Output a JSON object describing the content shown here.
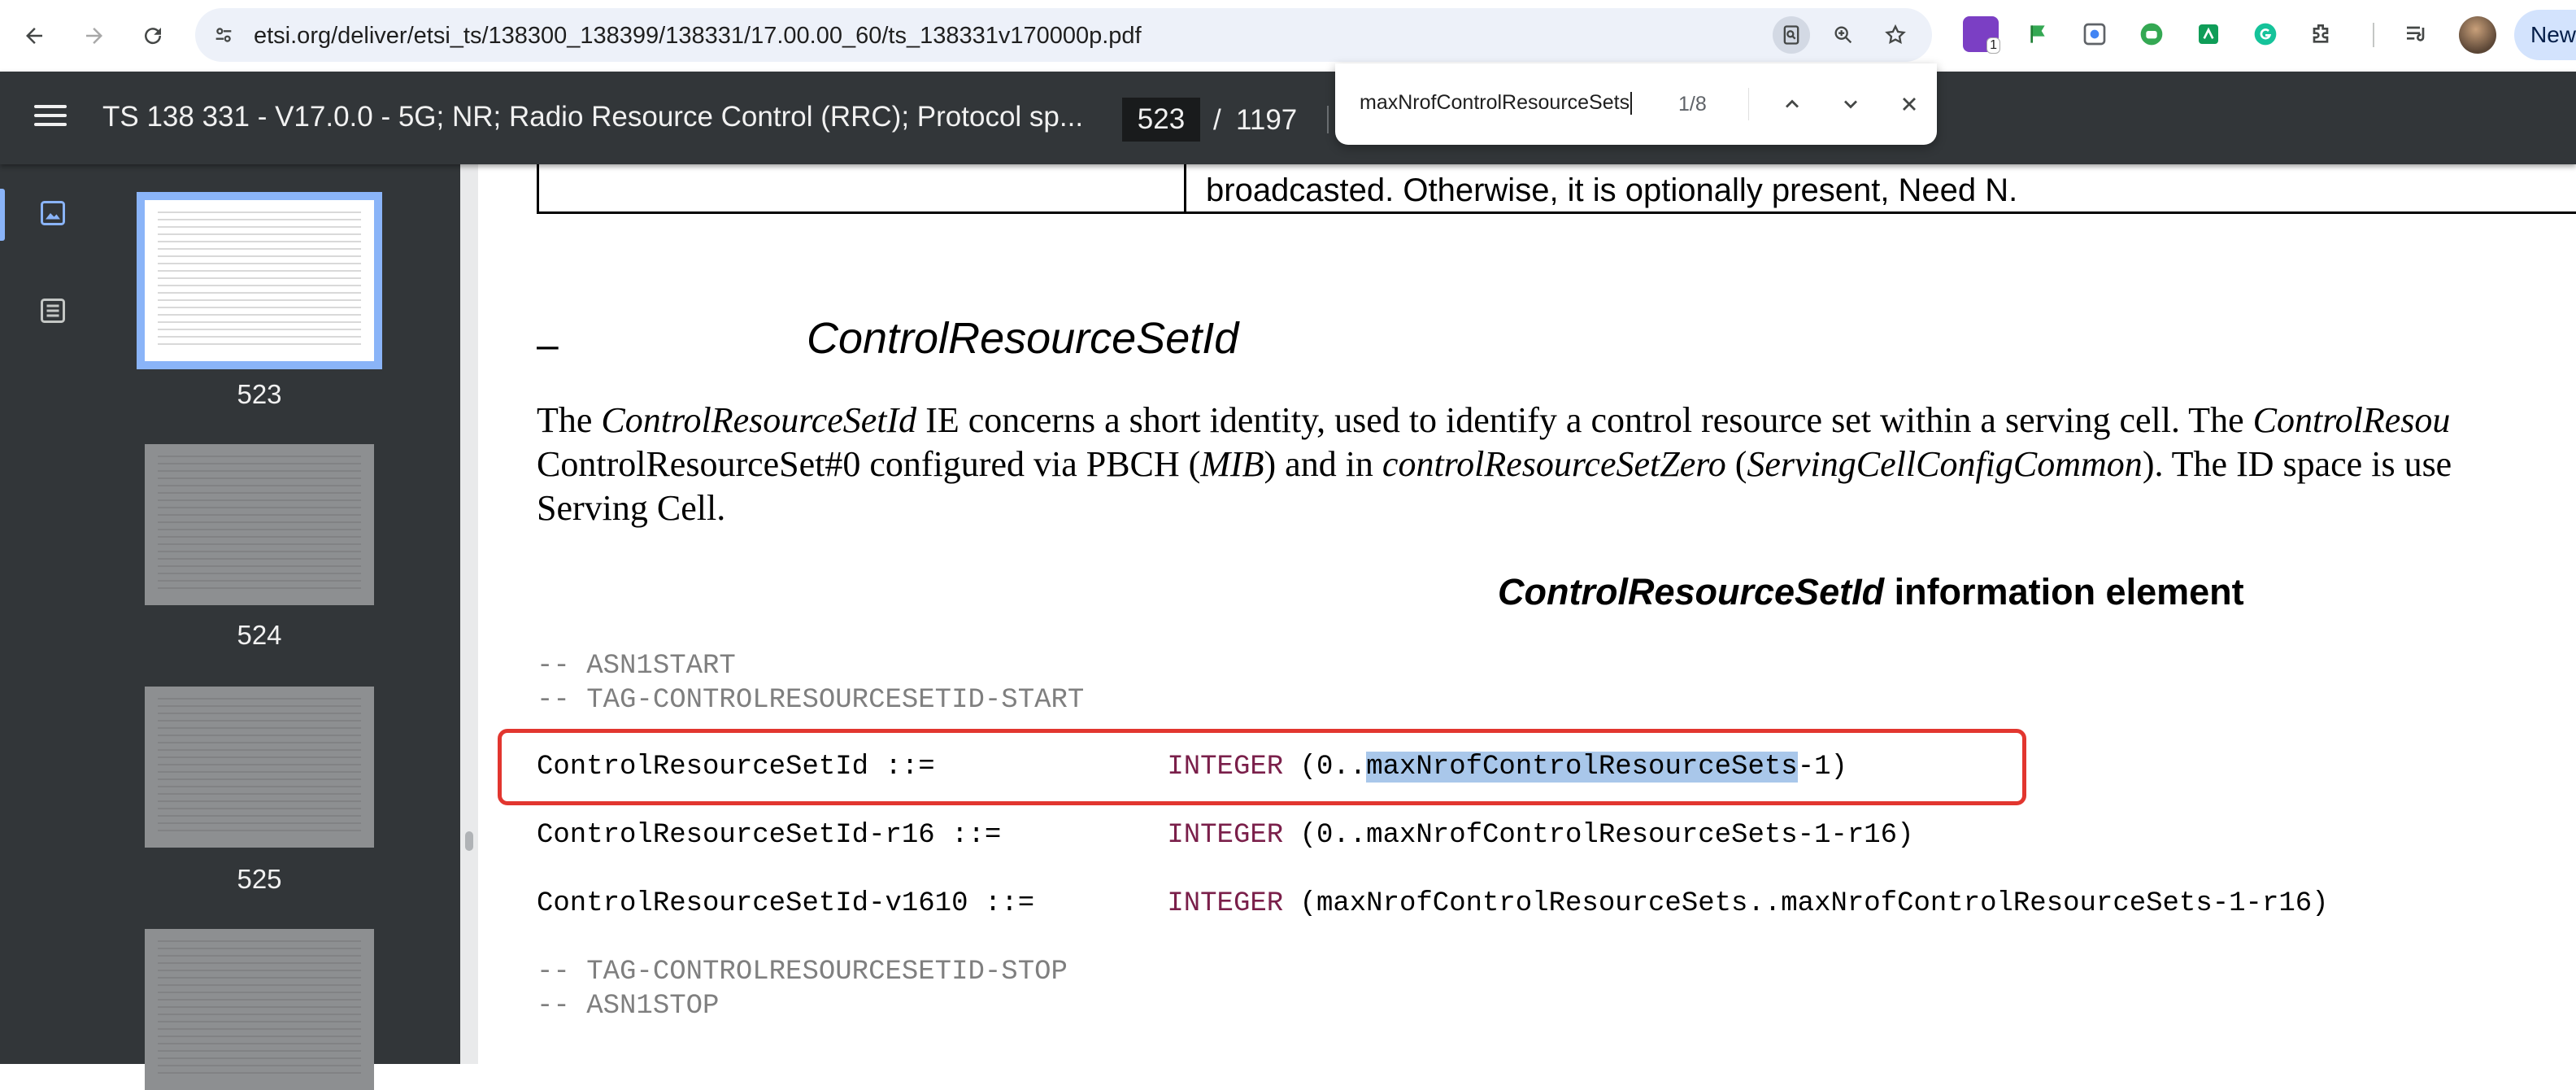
{
  "browser": {
    "url": "etsi.org/deliver/etsi_ts/138300_138399/138331/17.00.00_60/ts_138331v170000p.pdf",
    "extension_badge": "1",
    "new_button_label": "New",
    "icons": [
      "back-arrow-icon",
      "forward-arrow-icon",
      "reload-icon",
      "site-info-icon",
      "pdf-search-icon",
      "zoom-icon",
      "star-icon",
      "extensions-puzzle-icon",
      "media-control-icon"
    ]
  },
  "viewer": {
    "title": "TS 138 331 - V17.0.0 - 5G; NR; Radio Resource Control (RRC); Protocol sp...",
    "current_page": "523",
    "separator": "/",
    "total_pages": "1197"
  },
  "find": {
    "query": "maxNrofControlResourceSets",
    "count": "1/8"
  },
  "thumbnails": [
    {
      "page": "523",
      "selected": true
    },
    {
      "page": "524",
      "selected": false
    },
    {
      "page": "525",
      "selected": false
    },
    {
      "page": "",
      "selected": false
    }
  ],
  "document": {
    "table_fragment": "broadcasted. Otherwise, it is optionally present, Need N.",
    "clause_dash": "–",
    "clause_title": "ControlResourceSetId",
    "para": {
      "l1_a": "The ",
      "l1_b": "ControlResourceSetId",
      "l1_c": " IE concerns a short identity, used to identify a control resource set within a serving cell. The ",
      "l1_d": "ControlResou",
      "l2_a": "ControlResourceSet#0 configured via PBCH (",
      "l2_b": "MIB",
      "l2_c": ") and in ",
      "l2_d": "controlResourceSetZero",
      "l2_e": " (",
      "l2_f": "ServingCellConfigCommon",
      "l2_g": "). The ID space is use",
      "l3": "Serving Cell."
    },
    "ie_heading_italic": "ControlResourceSetId",
    "ie_heading_rest": " information element",
    "asn": {
      "c1": "-- ASN1START",
      "c2": "-- TAG-CONTROLRESOURCESETID-START",
      "l1_name": "ControlResourceSetId ::=              ",
      "l1_type": "INTEGER",
      "l1_pre": " (0..",
      "l1_hl": "maxNrofControlResourceSets",
      "l1_post": "-1)",
      "l2_name": "ControlResourceSetId-r16 ::=          ",
      "l2_type": "INTEGER",
      "l2_rest": " (0..maxNrofControlResourceSets-1-r16)",
      "l3_name": "ControlResourceSetId-v1610 ::=        ",
      "l3_type": "INTEGER",
      "l3_rest": " (maxNrofControlResourceSets..maxNrofControlResourceSets-1-r16)",
      "c3": "-- TAG-CONTROLRESOURCESETID-STOP",
      "c4": "-- ASN1STOP"
    }
  },
  "colors": {
    "viewer_bg": "#323639",
    "highlight": "#a9c7ea",
    "annotation_box": "#e2362f",
    "asn_keyword": "#7a1f4a"
  }
}
